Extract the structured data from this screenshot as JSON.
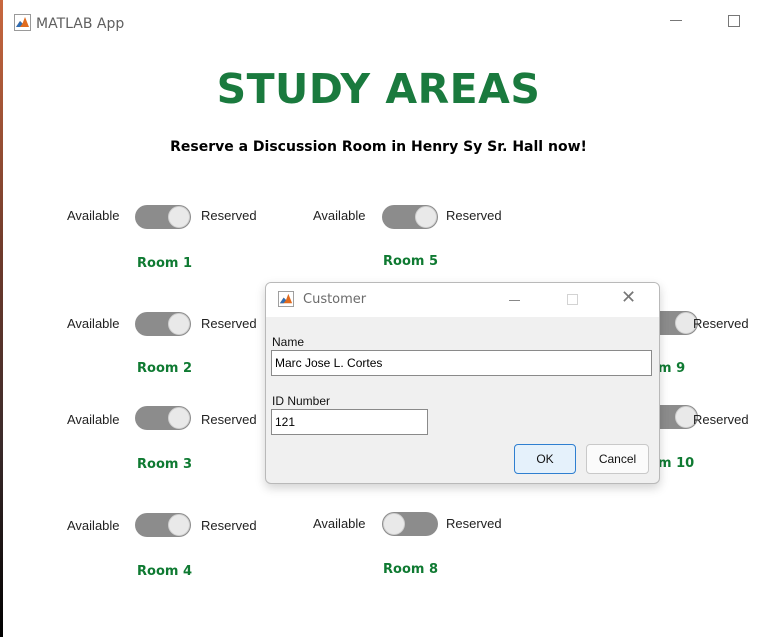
{
  "window": {
    "title": "MATLAB App"
  },
  "heading": "STUDY AREAS",
  "subheading": "Reserve a Discussion Room in Henry Sy Sr. Hall now!",
  "switch_labels": {
    "left": "Available",
    "right": "Reserved"
  },
  "rooms": {
    "room1": "Room 1",
    "room2": "Room 2",
    "room3": "Room 3",
    "room4": "Room 4",
    "room5": "Room 5",
    "room8": "Room 8",
    "room9_partial": "m 9",
    "room10_partial": "m 10"
  },
  "toggles": {
    "room1": "Reserved",
    "room2": "Reserved",
    "room3": "Reserved",
    "room4": "Reserved",
    "room5": "Reserved",
    "room8": "Available",
    "room9": "Reserved",
    "room10": "Reserved"
  },
  "dialog": {
    "title": "Customer",
    "name_label": "Name",
    "name_value": "Marc Jose L. Cortes",
    "id_label": "ID Number",
    "id_value": "121",
    "ok_label": "OK",
    "cancel_label": "Cancel"
  },
  "colors": {
    "heading": "#1a7a3e",
    "room_label": "#0f7a32",
    "switch_track": "#8c8c8c"
  }
}
